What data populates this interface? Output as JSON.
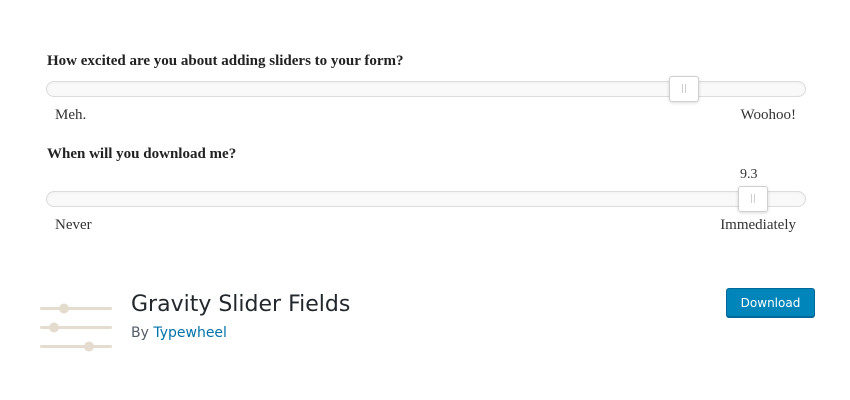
{
  "form": {
    "slider1": {
      "question": "How excited are you about adding sliders to your form?",
      "min_label": "Meh.",
      "max_label": "Woohoo!",
      "level_fraction": 0.839
    },
    "slider2": {
      "question": "When will you download me?",
      "min_label": "Never",
      "max_label": "Immediately",
      "value": "9.3",
      "level_fraction": 0.93
    }
  },
  "plugin": {
    "name": "Gravity Slider Fields",
    "by_label": "By",
    "author": "Typewheel",
    "download_label": "Download",
    "icon": "slider-lines-icon",
    "accent_color": "#0085ba",
    "link_color": "#0073aa",
    "icon_color": "#e5dcd0"
  }
}
